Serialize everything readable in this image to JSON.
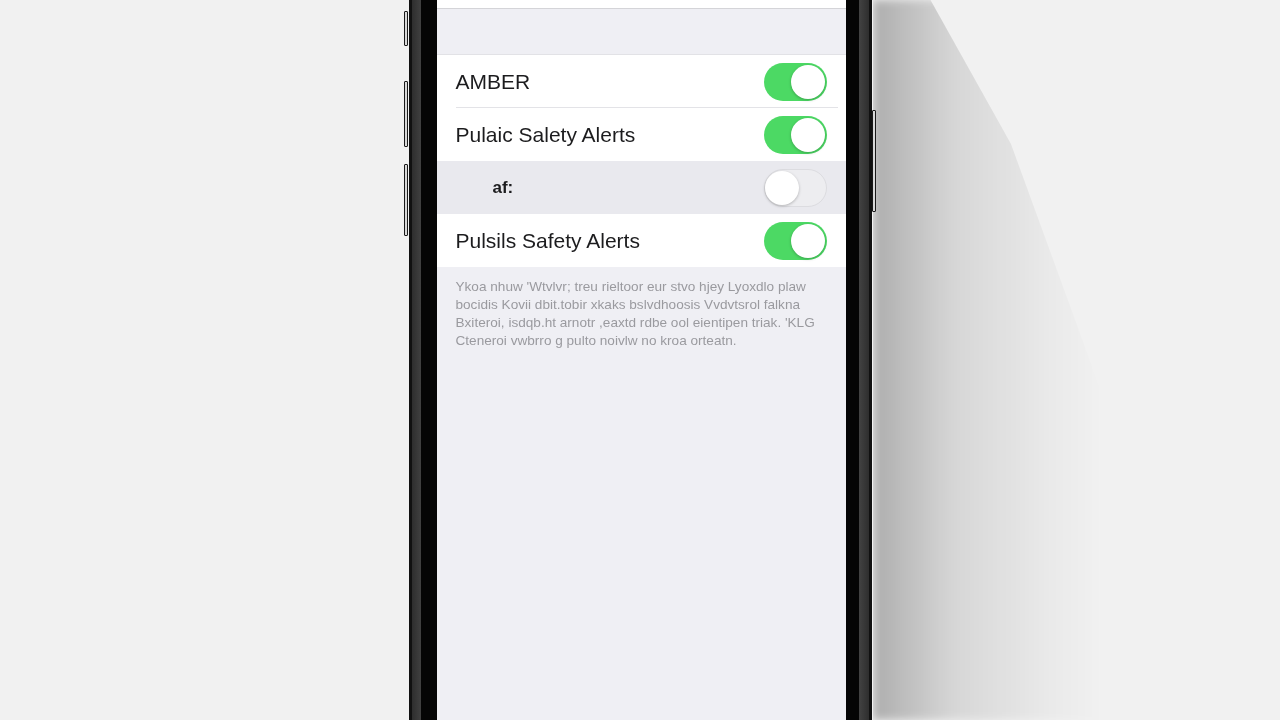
{
  "screen": {
    "toggles": [
      {
        "label": "AMBER",
        "on": true
      },
      {
        "label": "Pulaic Salety Alerts",
        "on": true,
        "children": [
          {
            "label": "af:",
            "on": false
          }
        ]
      },
      {
        "label": "Pulsils Safety Alerts",
        "on": true
      }
    ],
    "footer": "Ykoa nhuw 'Wtvlvr; treu rieltoor eur stvo hjey Lyoxdlo plaw bocidis Kovii dbit.tobir xkaks bslvdhoosis Vvdvtsrol falkna Bxiteroi, isdqb.ht arnotr ,eaxtd rdbe ool eientipen triak. 'KLG Cteneroi vwbrro g pulto noivlw no kroa orteatn."
  }
}
